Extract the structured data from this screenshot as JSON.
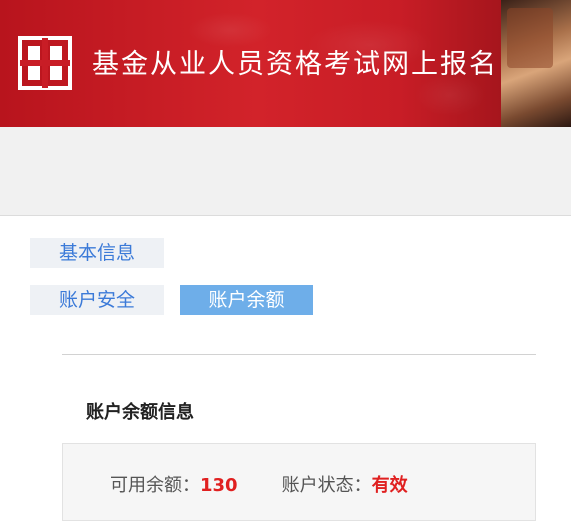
{
  "header": {
    "title": "基金从业人员资格考试网上报名",
    "logo_icon": "cfa-logo-icon",
    "brand_color": "#d2232a"
  },
  "hotline": {
    "text": ""
  },
  "tabs": [
    {
      "label": "基本信息",
      "active": false
    },
    {
      "label": "账户安全",
      "active": false
    },
    {
      "label": "账户余额",
      "active": true
    }
  ],
  "balance": {
    "section_title": "账户余额信息",
    "available_label": "可用余额：",
    "available_value": "130",
    "status_label": "账户状态：",
    "status_value": "有效",
    "value_color": "#e02020"
  }
}
